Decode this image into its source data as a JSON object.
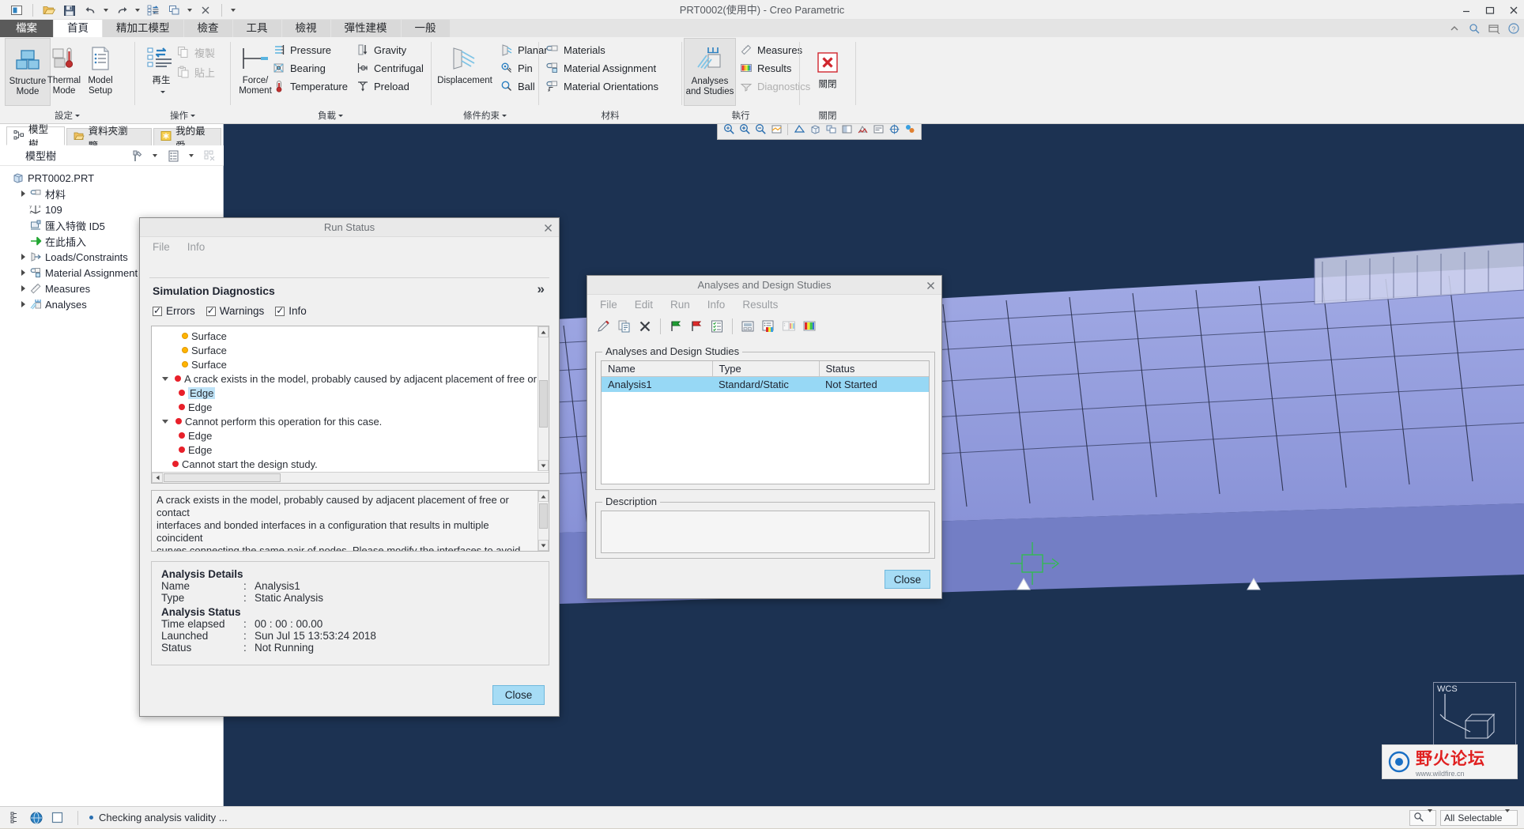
{
  "window": {
    "title": "PRT0002(使用中) - Creo Parametric",
    "minimize": "minimize-button",
    "maximize": "maximize-button",
    "close": "close-button"
  },
  "quick_access": {
    "items": [
      {
        "name": "new-window-icon"
      },
      {
        "name": "open-folder-icon"
      },
      {
        "name": "save-icon"
      },
      {
        "name": "undo-icon"
      },
      {
        "name": "undo-dropdown-icon"
      },
      {
        "name": "redo-icon"
      },
      {
        "name": "redo-dropdown-icon"
      },
      {
        "name": "regenerate-icon"
      },
      {
        "name": "window-switch-icon"
      },
      {
        "name": "window-switch-dropdown-icon"
      },
      {
        "name": "close-window-icon"
      },
      {
        "name": "customize-qat-icon"
      }
    ]
  },
  "ribbon": {
    "tabs": [
      {
        "label": "檔案",
        "kind": "file"
      },
      {
        "label": "首頁",
        "kind": "active"
      },
      {
        "label": "精加工模型",
        "kind": "normal"
      },
      {
        "label": "檢查",
        "kind": "normal"
      },
      {
        "label": "工具",
        "kind": "normal"
      },
      {
        "label": "檢視",
        "kind": "normal"
      },
      {
        "label": "彈性建模",
        "kind": "normal"
      },
      {
        "label": "一般",
        "kind": "normal"
      }
    ],
    "groups": [
      {
        "label": "設定"
      },
      {
        "label": "操作"
      },
      {
        "label": "負載"
      },
      {
        "label": "條件約束"
      },
      {
        "label": "材料"
      },
      {
        "label": "執行"
      },
      {
        "label": "關閉"
      }
    ],
    "setup": {
      "structure_mode": "Structure\nMode",
      "thermal_mode": "Thermal\nMode",
      "model_setup": "Model\nSetup"
    },
    "operations": {
      "regenerate": "再生",
      "copy": "複製",
      "paste": "貼上"
    },
    "loads": {
      "force_moment": "Force/\nMoment",
      "pressure": "Pressure",
      "bearing": "Bearing",
      "temperature": "Temperature",
      "gravity": "Gravity",
      "centrifugal": "Centrifugal",
      "preload": "Preload"
    },
    "constraints": {
      "displacement": "Displacement",
      "planar": "Planar",
      "pin": "Pin",
      "ball": "Ball"
    },
    "materials": {
      "materials": "Materials",
      "material_assignment": "Material Assignment",
      "material_orientations": "Material Orientations"
    },
    "run": {
      "analyses_and_studies": "Analyses\nand Studies",
      "measures": "Measures",
      "results": "Results",
      "diagnostics": "Diagnostics"
    },
    "close_group": {
      "close": "關閉"
    }
  },
  "left_panel": {
    "tabs": [
      {
        "label": "模型樹",
        "icon": "model-tree-icon",
        "active": true
      },
      {
        "label": "資料夾瀏覽...",
        "icon": "folder-browser-icon",
        "active": false
      },
      {
        "label": "我的最愛",
        "icon": "favorites-icon",
        "active": false
      }
    ],
    "toolbar_label": "模型樹",
    "tree": [
      {
        "label": "PRT0002.PRT",
        "icon": "part-icon",
        "indent": 0,
        "expand": false
      },
      {
        "label": "材料",
        "icon": "material-icon",
        "indent": 1,
        "expand": true
      },
      {
        "label": "109",
        "icon": "coordinate-icon",
        "indent": 1,
        "expand": false
      },
      {
        "label": "匯入特徵 ID5",
        "icon": "import-feature-icon",
        "indent": 1,
        "expand": false
      },
      {
        "label": "在此插入",
        "icon": "insert-here-icon",
        "indent": 1,
        "expand": false
      },
      {
        "label": "Loads/Constraints",
        "icon": "loads-constraints-icon",
        "indent": 1,
        "expand": true
      },
      {
        "label": "Material Assignment",
        "icon": "material-assignment-icon",
        "indent": 1,
        "expand": true
      },
      {
        "label": "Measures",
        "icon": "measures-icon",
        "indent": 1,
        "expand": true
      },
      {
        "label": "Analyses",
        "icon": "analyses-icon",
        "indent": 1,
        "expand": true
      }
    ]
  },
  "run_status": {
    "title": "Run Status",
    "menu": [
      "File",
      "Info"
    ],
    "heading": "Simulation Diagnostics",
    "filters": [
      {
        "label": "Errors",
        "checked": true
      },
      {
        "label": "Warnings",
        "checked": true
      },
      {
        "label": "Info",
        "checked": true
      }
    ],
    "expand_chevron": "»",
    "diagnostics": [
      {
        "text": "Surface",
        "severity": "warning",
        "indent": 2,
        "expander": false,
        "selected": false
      },
      {
        "text": "Surface",
        "severity": "warning",
        "indent": 2,
        "expander": false,
        "selected": false
      },
      {
        "text": "Surface",
        "severity": "warning",
        "indent": 2,
        "expander": false,
        "selected": false
      },
      {
        "text": "A crack exists in the model, probably caused by adjacent placement of free or",
        "severity": "error",
        "indent": 1,
        "expander": true,
        "selected": false
      },
      {
        "text": "Edge",
        "severity": "error",
        "indent": 2,
        "expander": false,
        "selected": true
      },
      {
        "text": "Edge",
        "severity": "error",
        "indent": 2,
        "expander": false,
        "selected": false
      },
      {
        "text": "Cannot perform this operation for this case.",
        "severity": "error",
        "indent": 1,
        "expander": true,
        "selected": false
      },
      {
        "text": "Edge",
        "severity": "error",
        "indent": 2,
        "expander": false,
        "selected": false
      },
      {
        "text": "Edge",
        "severity": "error",
        "indent": 2,
        "expander": false,
        "selected": false
      },
      {
        "text": "Cannot start the design study.",
        "severity": "error",
        "indent": 1,
        "expander": false,
        "selected": false
      }
    ],
    "message_lines": [
      "A crack exists in the model, probably caused by adjacent placement of free or",
      "contact",
      "interfaces and bonded interfaces in a configuration that results in multiple",
      "coincident",
      "curves connecting the same pair of nodes. Please modify the interfaces to avoid"
    ],
    "analysis_details_title": "Analysis Details",
    "details": [
      {
        "key": "Name",
        "sep": ":",
        "value": "Analysis1"
      },
      {
        "key": "Type",
        "sep": ":",
        "value": "Static Analysis"
      }
    ],
    "analysis_status_title": "Analysis Status",
    "status_rows": [
      {
        "key": "Time elapsed",
        "sep": ":",
        "value": "00 : 00 : 00.00"
      },
      {
        "key": "Launched",
        "sep": ":",
        "value": "Sun Jul 15 13:53:24 2018"
      },
      {
        "key": "Status",
        "sep": ":",
        "value": "Not Running"
      }
    ],
    "close_button": "Close"
  },
  "analyses_dialog": {
    "title": "Analyses and Design Studies",
    "menu": [
      "File",
      "Edit",
      "Run",
      "Info",
      "Results"
    ],
    "toolbar_icons": [
      {
        "name": "edit-pencil-icon",
        "disabled": false
      },
      {
        "name": "copy-icon",
        "disabled": false
      },
      {
        "name": "delete-x-icon",
        "disabled": false
      },
      {
        "name": "start-run-green-flag-icon",
        "disabled": false
      },
      {
        "name": "stop-run-red-flag-icon",
        "disabled": false
      },
      {
        "name": "run-settings-icon",
        "disabled": false
      },
      {
        "name": "display-status-icon",
        "disabled": false
      },
      {
        "name": "display-study-status-icon",
        "disabled": false
      },
      {
        "name": "results-window-icon",
        "disabled": true
      },
      {
        "name": "results-display-icon",
        "disabled": false
      }
    ],
    "group_caption": "Analyses and Design Studies",
    "columns": [
      "Name",
      "Type",
      "Status"
    ],
    "rows": [
      {
        "name": "Analysis1",
        "type": "Standard/Static",
        "status": "Not Started",
        "selected": true
      }
    ],
    "description_caption": "Description",
    "description_value": "",
    "close_button": "Close"
  },
  "graphics_toolbar": {
    "icons": [
      {
        "name": "refit-zoom-icon"
      },
      {
        "name": "zoom-in-icon"
      },
      {
        "name": "zoom-out-icon"
      },
      {
        "name": "repaint-icon"
      },
      {
        "name": "perspective-view-icon"
      },
      {
        "name": "saved-orientations-icon"
      },
      {
        "name": "view-manager-icon"
      },
      {
        "name": "display-style-icon"
      },
      {
        "name": "datum-display-icon"
      },
      {
        "name": "annotation-display-icon"
      },
      {
        "name": "spin-center-icon"
      },
      {
        "name": "appearance-gallery-icon"
      }
    ]
  },
  "status_bar": {
    "message": "Checking analysis validity ...",
    "left_icons": [
      {
        "name": "model-tree-toggle-icon"
      },
      {
        "name": "browser-toggle-icon"
      },
      {
        "name": "graphics-window-toggle-icon"
      }
    ],
    "right": {
      "search_icon": "search-icon",
      "search_dropdown_icon": "chevron-down-icon",
      "selection_filter": "All",
      "selection_label": "Selectable",
      "selection_dropdown_icon": "chevron-down-icon"
    }
  },
  "watermark": {
    "text": "野火论坛",
    "sub": "www.wildfire.cn"
  },
  "wcs_label": "WCS",
  "colors": {
    "graphics_bg": "#1c3252",
    "model_fill": "#9aa3e8",
    "accent_blue": "#a6dcf5",
    "selection_blue": "#97d8f5",
    "error_red": "#e8202a",
    "warning_yellow": "#ffb400",
    "ribbon_bg": "#f1f1f1",
    "file_tab": "#5a5a5a"
  }
}
